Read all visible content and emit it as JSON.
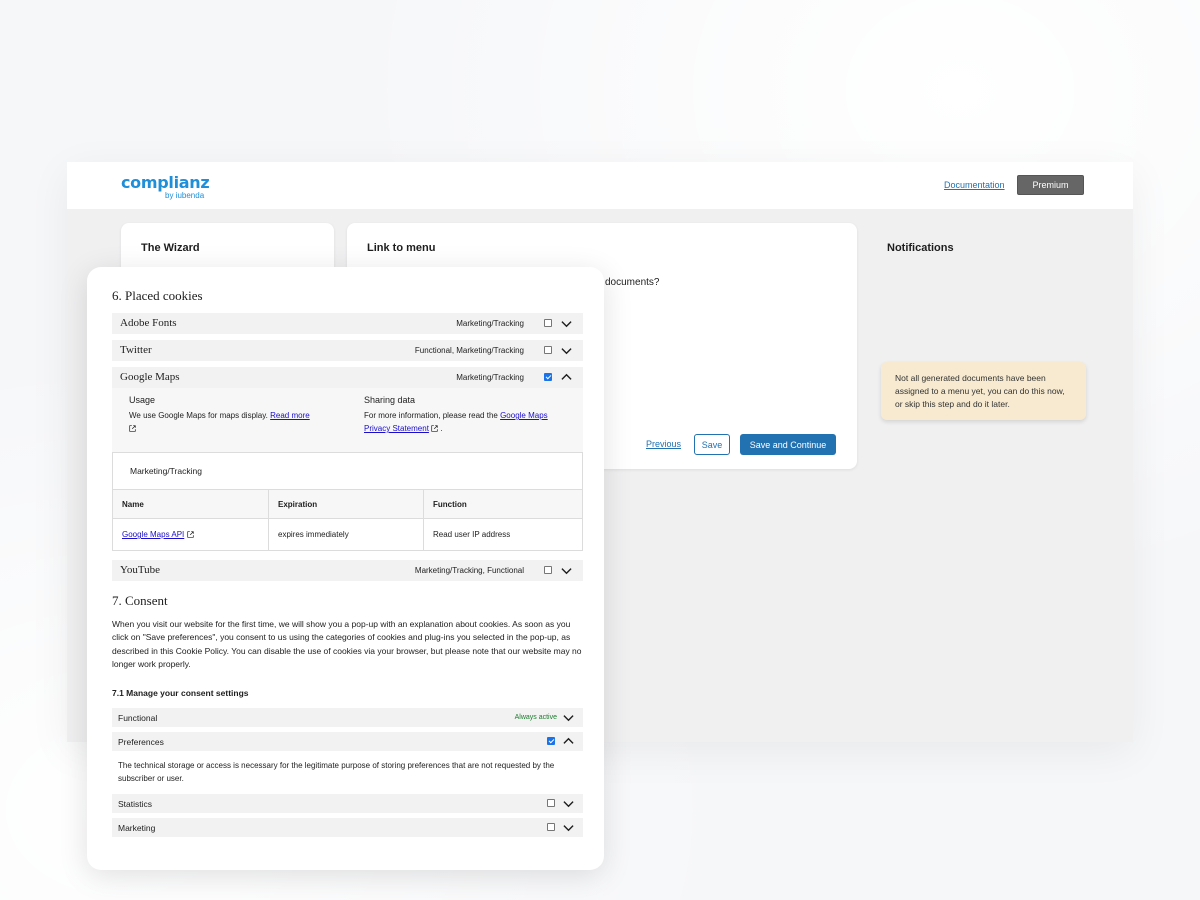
{
  "header": {
    "logo_main": "complianz",
    "logo_sub": "by iubenda",
    "documentation": "Documentation",
    "premium": "Premium"
  },
  "wizard": {
    "title": "The Wizard"
  },
  "link_menu": {
    "title": "Link to menu",
    "question": "documents?",
    "previous": "Previous",
    "save": "Save",
    "save_continue": "Save and Continue"
  },
  "notifications": {
    "title": "Notifications",
    "message": "Not all generated documents have been assigned to a menu yet, you can do this now, or skip this step and do it later."
  },
  "placed_cookies": {
    "heading": "6. Placed cookies",
    "services": [
      {
        "name": "Adobe Fonts",
        "category": "Marketing/Tracking",
        "checked": false,
        "expanded": false
      },
      {
        "name": "Twitter",
        "category": "Functional, Marketing/Tracking",
        "checked": false,
        "expanded": false
      },
      {
        "name": "Google Maps",
        "category": "Marketing/Tracking",
        "checked": true,
        "expanded": true
      },
      {
        "name": "YouTube",
        "category": "Marketing/Tracking, Functional",
        "checked": false,
        "expanded": false
      }
    ],
    "detail": {
      "usage_title": "Usage",
      "usage_text": "We use Google Maps for maps display.",
      "read_more": "Read more",
      "sharing_title": "Sharing data",
      "sharing_text": "For more information, please read the",
      "sharing_link_1": "Google Maps",
      "sharing_link_2": "Privacy Statement",
      "sharing_end": "."
    },
    "table": {
      "category": "Marketing/Tracking",
      "headers": [
        "Name",
        "Expiration",
        "Function"
      ],
      "rows": [
        {
          "name": "Google Maps API",
          "expiration": "expires immediately",
          "function": "Read user IP address"
        }
      ]
    }
  },
  "consent": {
    "heading": "7. Consent",
    "text": "When you visit our website for the first time, we will show you a pop-up with an explanation about cookies. As soon as you click on \"Save preferences\", you consent to us using the categories of cookies and plug-ins you selected in the pop-up, as described in this Cookie Policy. You can disable the use of cookies via your browser, but please note that our website may no longer work properly.",
    "sub_heading": "7.1 Manage your consent settings",
    "functional": "Functional",
    "always_active": "Always active",
    "preferences": "Preferences",
    "preferences_text": "The technical storage or access is necessary for the legitimate purpose of storing preferences that are not requested by the subscriber or user.",
    "statistics": "Statistics",
    "marketing": "Marketing"
  },
  "colors": {
    "brand": "#1e8fd8",
    "primary_button": "#2271b1",
    "notice_bg": "#f7ead0",
    "checkbox_checked": "#1a73e8"
  }
}
